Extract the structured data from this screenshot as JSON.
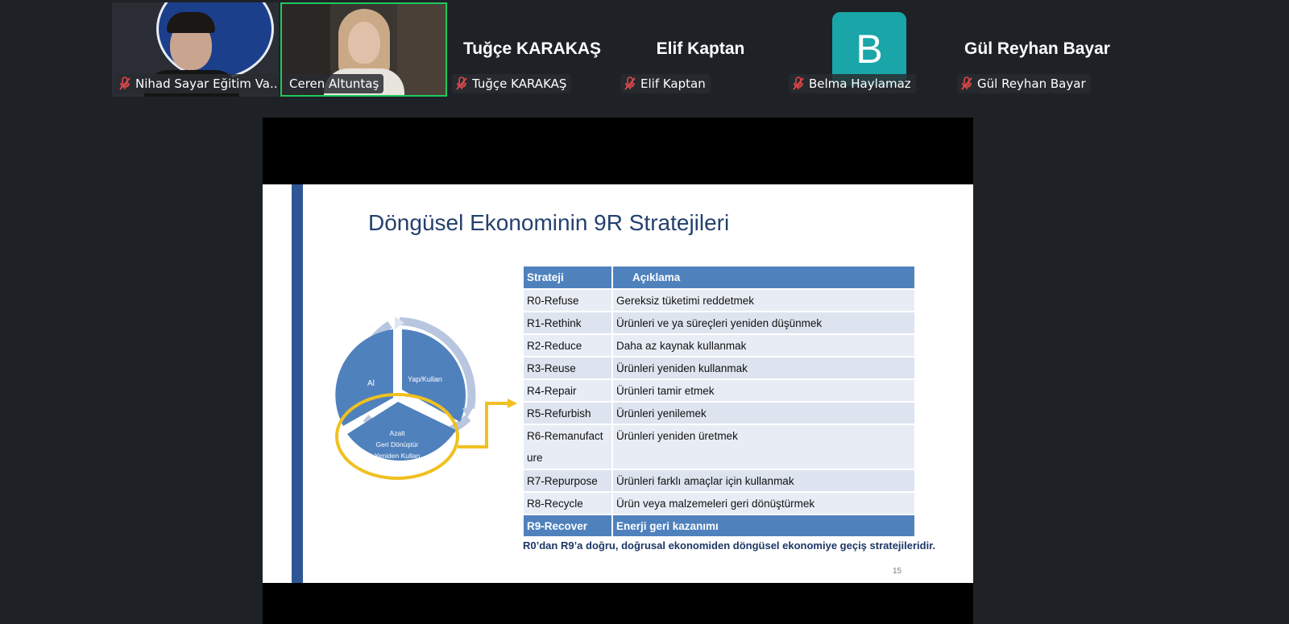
{
  "participants": [
    {
      "tag_name": "Nihad Sayar Eğitim Va...",
      "muted": true,
      "type": "video"
    },
    {
      "tag_name": "Ceren Altuntaş",
      "muted": false,
      "type": "video",
      "speaking": true
    },
    {
      "display_name": "Tuğçe KARAKAŞ",
      "tag_name": "Tuğçe KARAKAŞ",
      "muted": true,
      "type": "name"
    },
    {
      "display_name": "Elif Kaptan",
      "tag_name": "Elif Kaptan",
      "muted": true,
      "type": "name"
    },
    {
      "avatar_letter": "B",
      "tag_name": "Belma Haylamaz",
      "muted": true,
      "type": "avatar"
    },
    {
      "display_name": "Gül Reyhan Bayar",
      "tag_name": "Gül Reyhan Bayar",
      "muted": true,
      "type": "name"
    }
  ],
  "slide": {
    "title": "Döngüsel Ekonominin 9R Stratejileri",
    "cycle": {
      "left_label": "Al",
      "right_label": "Yap/Kullan",
      "bottom_line1": "Azalt",
      "bottom_line2": "Geri Dönüştür",
      "bottom_line3": "Yeniden Kullan"
    },
    "table": {
      "headers": [
        "Strateji",
        "Açıklama"
      ],
      "rows": [
        [
          "R0-Refuse",
          "Gereksiz tüketimi reddetmek"
        ],
        [
          "R1-Rethink",
          "Ürünleri ve ya süreçleri yeniden düşünmek"
        ],
        [
          "R2-Reduce",
          "Daha az kaynak kullanmak"
        ],
        [
          "R3-Reuse",
          "Ürünleri yeniden kullanmak"
        ],
        [
          "R4-Repair",
          "Ürünleri tamir etmek"
        ],
        [
          "R5-Refurbish",
          "Ürünleri yenilemek"
        ],
        [
          "R6-Remanufacture",
          "Ürünleri yeniden üretmek"
        ],
        [
          "R7-Repurpose",
          "Ürünleri farklı amaçlar için kullanmak"
        ],
        [
          "R8-Recycle",
          "Ürün veya malzemeleri geri dönüştürmek"
        ],
        [
          "R9-Recover",
          "Enerji geri kazanımı"
        ]
      ]
    },
    "caption": "R0’dan R9’a doğru, doğrusal ekonomiden döngüsel ekonomiye geçiş stratejileridir.",
    "page_number": "15"
  },
  "colors": {
    "background": "#1e2227",
    "speaking_border": "#1fc95d",
    "avatar_bg": "#1aa6a9",
    "slide_accent": "#2f5694",
    "table_header": "#4f81bd",
    "highlight_ring": "#f0c020"
  }
}
